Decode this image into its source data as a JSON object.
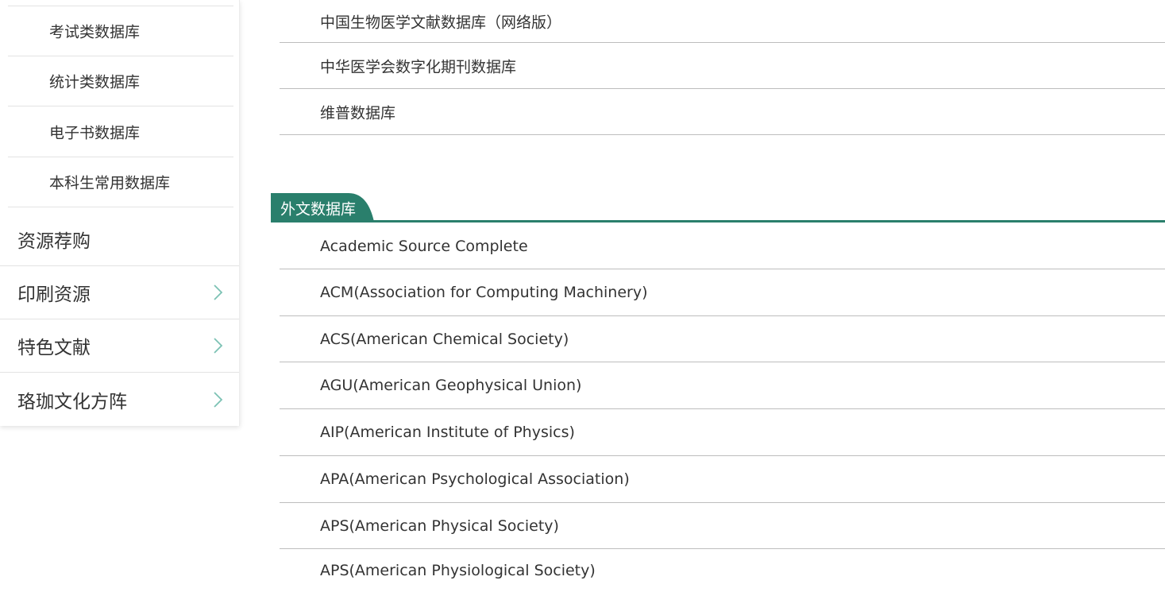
{
  "sidebar": {
    "sub_items": [
      {
        "label": "考试类数据库"
      },
      {
        "label": "统计类数据库"
      },
      {
        "label": "电子书数据库"
      },
      {
        "label": "本科生常用数据库"
      }
    ],
    "main_items": [
      {
        "label": "资源荐购",
        "icon": null
      },
      {
        "label": "印刷资源",
        "icon": "chevron-right-icon"
      },
      {
        "label": "特色文献",
        "icon": "chevron-right-icon"
      },
      {
        "label": "珞珈文化方阵",
        "icon": "chevron-right-icon"
      }
    ]
  },
  "chinese_databases": [
    {
      "label": "中国生物医学文献数据库（网络版）"
    },
    {
      "label": "中华医学会数字化期刊数据库"
    },
    {
      "label": "维普数据库"
    }
  ],
  "foreign_section": {
    "title": "外文数据库",
    "items": [
      {
        "label": "Academic Source Complete"
      },
      {
        "label": "ACM(Association for Computing Machinery)"
      },
      {
        "label": "ACS(American Chemical Society)"
      },
      {
        "label": "AGU(American Geophysical Union)"
      },
      {
        "label": "AIP(American Institute of Physics)"
      },
      {
        "label": "APA(American Psychological Association)"
      },
      {
        "label": "APS(American Physical Society)"
      },
      {
        "label": "APS(American Physiological Society)"
      }
    ]
  },
  "colors": {
    "accent": "#2a7f6c",
    "chevron": "#7cc2b4",
    "divider": "#bdbdbd"
  }
}
